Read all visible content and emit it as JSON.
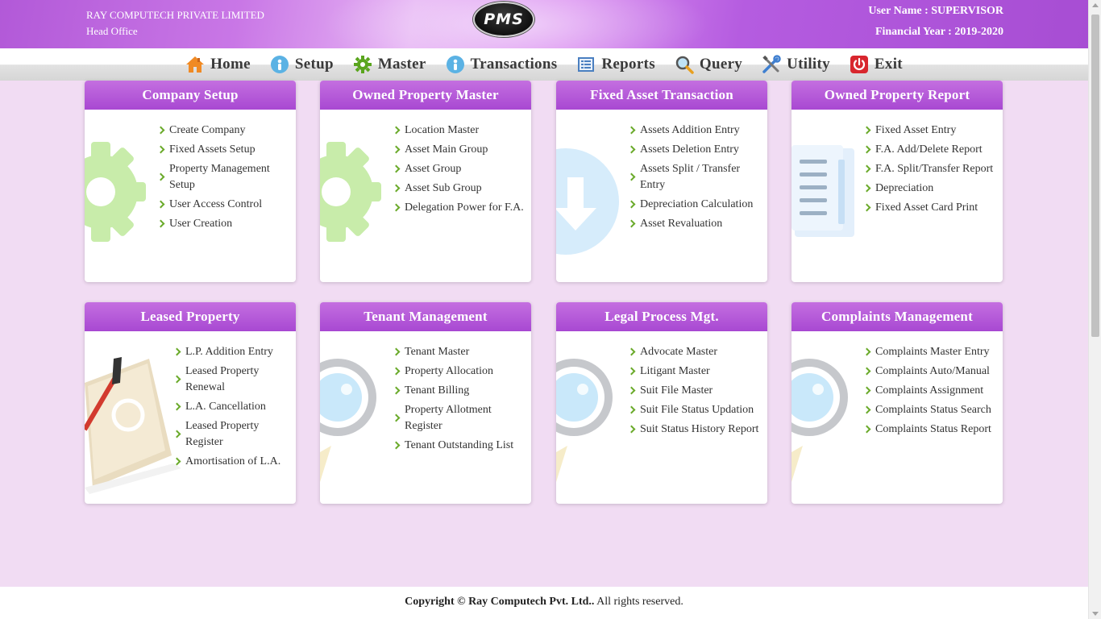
{
  "header": {
    "company_name": "RAY COMPUTECH PRIVATE LIMITED",
    "branch": "Head Office",
    "logo_text": "PMS",
    "user_line": "User Name : SUPERVISOR",
    "fy_line": "Financial Year : 2019-2020"
  },
  "nav": {
    "home": "Home",
    "setup": "Setup",
    "master": "Master",
    "transactions": "Transactions",
    "reports": "Reports",
    "query": "Query",
    "utility": "Utility",
    "exit": "Exit"
  },
  "cards": {
    "company_setup": {
      "title": "Company Setup",
      "items": [
        "Create Company",
        "Fixed Assets Setup",
        "Property Management Setup",
        "User Access Control",
        "User Creation"
      ]
    },
    "owned_property_master": {
      "title": "Owned Property Master",
      "items": [
        "Location Master",
        "Asset Main Group",
        "Asset Group",
        "Asset Sub Group",
        "Delegation Power for F.A."
      ]
    },
    "fixed_asset_transaction": {
      "title": "Fixed Asset Transaction",
      "items": [
        "Assets Addition Entry",
        "Assets Deletion Entry",
        "Assets Split / Transfer Entry",
        "Depreciation Calculation",
        "Asset Revaluation"
      ]
    },
    "owned_property_report": {
      "title": "Owned Property Report",
      "items": [
        "Fixed Asset Entry",
        "F.A. Add/Delete Report",
        "F.A. Split/Transfer Report",
        "Depreciation",
        "Fixed Asset Card Print"
      ]
    },
    "leased_property": {
      "title": "Leased Property",
      "items": [
        "L.P. Addition Entry",
        "Leased Property Renewal",
        "L.A. Cancellation",
        "Leased Property Register",
        "Amortisation of L.A."
      ]
    },
    "tenant_management": {
      "title": "Tenant Management",
      "items": [
        "Tenant Master",
        "Property Allocation",
        "Tenant Billing",
        "Property Allotment Register",
        "Tenant Outstanding List"
      ]
    },
    "legal_process": {
      "title": "Legal Process Mgt.",
      "items": [
        "Advocate Master",
        "Litigant Master",
        "Suit File Master",
        "Suit File Status Updation",
        "Suit Status History Report"
      ]
    },
    "complaints_management": {
      "title": "Complaints Management",
      "items": [
        "Complaints Master Entry",
        "Complaints Auto/Manual",
        "Complaints Assignment",
        "Complaints Status Search",
        "Complaints Status Report"
      ]
    }
  },
  "footer": {
    "copyright": "Copyright © Ray Computech Pvt. Ltd..",
    "rights": " All rights reserved."
  },
  "colors": {
    "header_purple": "#b259d8",
    "card_header": "#a848d2",
    "page_bg": "#f1dcf3",
    "chevron_green": "#6aaa2a"
  },
  "icons": {
    "home": "house-icon",
    "setup": "person-icon",
    "master": "gear-icon",
    "transactions": "person-icon",
    "reports": "report-icon",
    "query": "magnifier-icon",
    "utility": "tools-icon",
    "exit": "power-icon"
  }
}
